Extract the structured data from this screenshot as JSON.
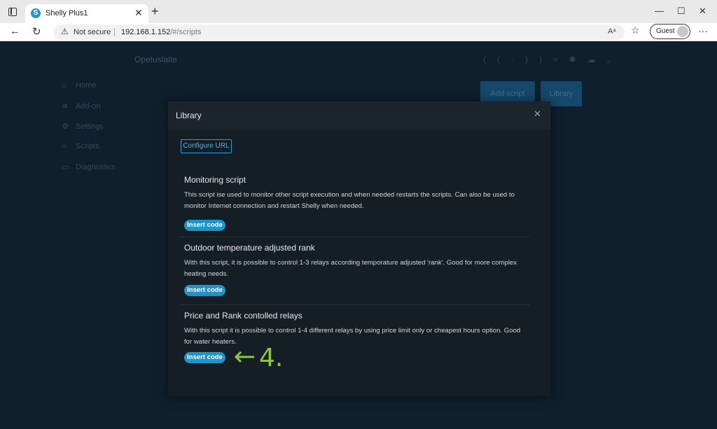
{
  "browser": {
    "tab_title": "Shelly Plus1",
    "favicon_letter": "S",
    "not_secure_label": "Not secure",
    "url_host": "192.168.1.152",
    "url_path": "/#/scripts",
    "guest_label": "Guest"
  },
  "app": {
    "device_name": "Opetuslaite",
    "sidebar": [
      {
        "label": "Home",
        "icon": "home-icon",
        "glyph": "⌂"
      },
      {
        "label": "Add-on",
        "icon": "layers-icon",
        "glyph": "≋"
      },
      {
        "label": "Settings",
        "icon": "gear-icon",
        "glyph": "⚙"
      },
      {
        "label": "Scripts",
        "icon": "code-icon",
        "glyph": "‹›"
      },
      {
        "label": "Diagnostics",
        "icon": "monitor-icon",
        "glyph": "▭"
      }
    ],
    "add_script_label": "Add script",
    "library_label": "Library"
  },
  "modal": {
    "title": "Library",
    "configure_url_label": "Configure URL",
    "scripts": [
      {
        "title": "Monitoring script",
        "description": "This script ise used to monitor other script execution and when needed restarts the scripts. Can also be used to monitor Internet connection and restart Shelly when needed.",
        "button": "Insert code"
      },
      {
        "title": "Outdoor temperature adjusted rank",
        "description": "With this script, it is possible to control 1-3 relays according temporature adjusted 'rank'. Good for more complex heating needs.",
        "button": "Insert code"
      },
      {
        "title": "Price and Rank contolled relays",
        "description": "With this script it is possible to control 1-4 different relays by using price limit only or cheapest hours option. Good for water heaters.",
        "button": "Insert code"
      }
    ]
  },
  "annotation": {
    "text": "4.",
    "color": "#8dc63f"
  },
  "colors": {
    "accent": "#1e95c9",
    "background": "#0f1f2e",
    "modal": "#151d25"
  }
}
